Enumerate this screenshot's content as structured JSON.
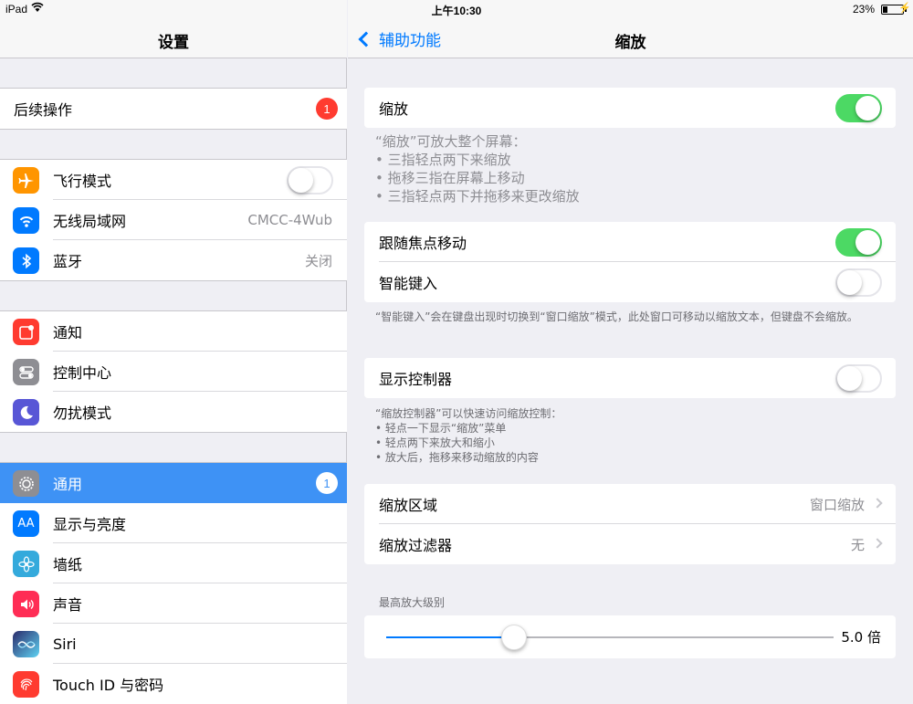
{
  "status": {
    "carrier": "iPad",
    "time": "上午10:30",
    "battery_pct": "23%",
    "battery_level": 0.23
  },
  "left": {
    "title": "设置",
    "follow_up": {
      "label": "后续操作",
      "badge": "1"
    },
    "group1": [
      {
        "label": "飞行模式",
        "icon": "airplane-icon",
        "color": "#ff9500",
        "toggle": false
      },
      {
        "label": "无线局域网",
        "icon": "wifi-icon",
        "color": "#007aff",
        "value": "CMCC-4Wub"
      },
      {
        "label": "蓝牙",
        "icon": "bluetooth-icon",
        "color": "#007aff",
        "value": "关闭"
      }
    ],
    "group2": [
      {
        "label": "通知",
        "icon": "notifications-icon",
        "color": "#ff3b30"
      },
      {
        "label": "控制中心",
        "icon": "control-center-icon",
        "color": "#8e8e93"
      },
      {
        "label": "勿扰模式",
        "icon": "moon-icon",
        "color": "#5856d6"
      }
    ],
    "group3": [
      {
        "label": "通用",
        "icon": "gear-icon",
        "color": "#8e8e93",
        "badge": "1",
        "selected": true
      },
      {
        "label": "显示与亮度",
        "icon": "text-size-icon",
        "color": "#007aff",
        "icon_text": "AA"
      },
      {
        "label": "墙纸",
        "icon": "flower-icon",
        "color": "#34aadc"
      },
      {
        "label": "声音",
        "icon": "speaker-icon",
        "color": "#ff2d55"
      },
      {
        "label": "Siri",
        "icon": "siri-icon",
        "color": "#333366"
      },
      {
        "label": "Touch ID 与密码",
        "icon": "fingerprint-icon",
        "color": "#ff3b30"
      }
    ]
  },
  "right": {
    "back_label": "辅助功能",
    "title": "缩放",
    "zoom": {
      "label": "缩放",
      "on": true
    },
    "zoom_info": {
      "title": "“缩放”可放大整个屏幕：",
      "items": [
        "• 三指轻点两下来缩放",
        "• 拖移三指在屏幕上移动",
        "• 三指轻点两下并拖移来更改缩放"
      ]
    },
    "follow_focus": {
      "label": "跟随焦点移动",
      "on": true
    },
    "smart_typing": {
      "label": "智能键入",
      "on": false
    },
    "smart_typing_note": "“智能键入”会在键盘出现时切换到“窗口缩放”模式，此处窗口可移动以缩放文本，但键盘不会缩放。",
    "show_controller": {
      "label": "显示控制器",
      "on": false
    },
    "controller_note": {
      "title": "“缩放控制器”可以快速访问缩放控制：",
      "items": [
        "• 轻点一下显示“缩放”菜单",
        "• 轻点两下来放大和缩小",
        "• 放大后，拖移来移动缩放的内容"
      ]
    },
    "zoom_region": {
      "label": "缩放区域",
      "value": "窗口缩放"
    },
    "zoom_filter": {
      "label": "缩放过滤器",
      "value": "无"
    },
    "max_zoom": {
      "label": "最高放大级别",
      "value": "5.0 倍",
      "level": 5.0,
      "min": 1.0,
      "max": 15.0
    }
  }
}
